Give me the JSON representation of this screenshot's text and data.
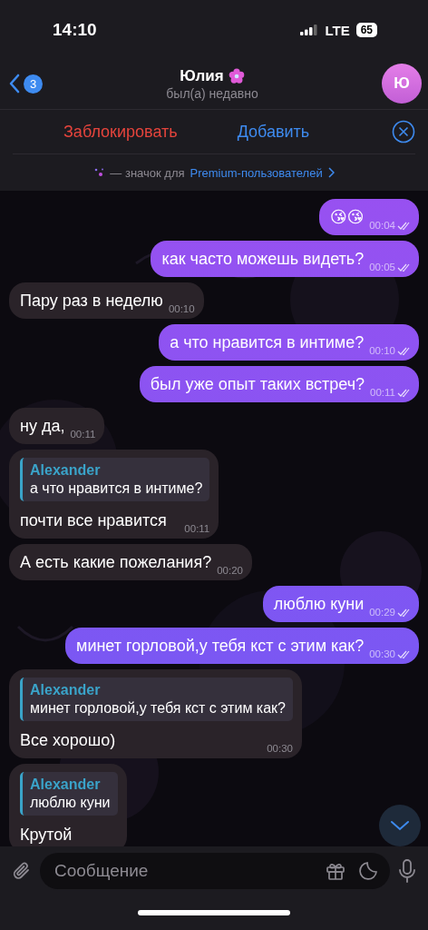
{
  "status_bar": {
    "time": "14:10",
    "network": "LTE",
    "battery": "65"
  },
  "header": {
    "back_count": "3",
    "title": "Юлия",
    "status": "был(а) недавно",
    "avatar_initial": "Ю"
  },
  "action_bar": {
    "block": "Заблокировать",
    "add": "Добавить"
  },
  "premium_note": {
    "text": "— значок для",
    "link": "Premium-пользователей"
  },
  "messages": [
    {
      "kind": "out",
      "text": "😘😘",
      "time": "00:04",
      "read": true
    },
    {
      "kind": "out",
      "text": "как часто можешь видеть?",
      "time": "00:05",
      "read": true
    },
    {
      "kind": "in",
      "text": "Пару раз в неделю",
      "time": "00:10"
    },
    {
      "kind": "out",
      "text": "а что нравится в интиме?",
      "time": "00:10",
      "read": true
    },
    {
      "kind": "out",
      "text": "был уже опыт таких встреч?",
      "time": "00:11",
      "read": true
    },
    {
      "kind": "in",
      "text": "ну да,",
      "time": "00:11"
    },
    {
      "kind": "in",
      "reply": {
        "name": "Alexander",
        "text": "а что нравится в интиме?"
      },
      "text": "почти все нравится",
      "time": "00:11"
    },
    {
      "kind": "in",
      "text": "А есть какие пожелания?",
      "time": "00:20"
    },
    {
      "kind": "out",
      "text": "люблю куни",
      "time": "00:29",
      "read": true
    },
    {
      "kind": "out",
      "text": "минет горловой,у тебя кст с этим как?",
      "time": "00:30",
      "read": true
    },
    {
      "kind": "in",
      "reply": {
        "name": "Alexander",
        "text": "минет горловой,у тебя кст с этим как?"
      },
      "text": "Все хорошо)",
      "time": "00:30"
    },
    {
      "kind": "in",
      "reply": {
        "name": "Alexander",
        "text": "люблю куни"
      },
      "text": "Крутой"
    }
  ],
  "composer": {
    "placeholder": "Сообщение"
  }
}
